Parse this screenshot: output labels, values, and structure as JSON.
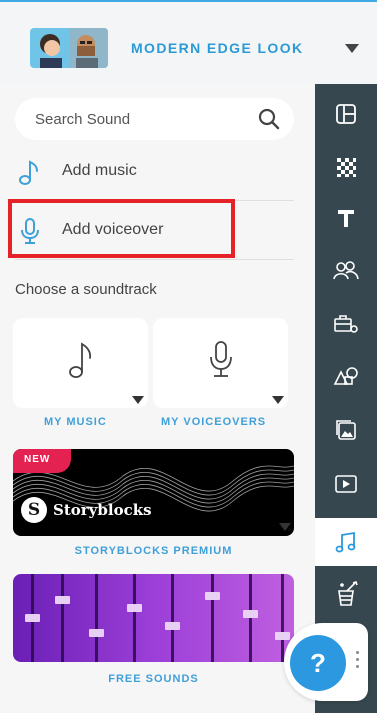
{
  "header": {
    "title": "MODERN EDGE LOOK",
    "avatar_icon": "team-avatar-icon",
    "dropdown_icon": "caret-down-icon"
  },
  "sound_panel": {
    "search": {
      "placeholder": "Search Sound",
      "icon": "search-icon"
    },
    "add_music": {
      "label": "Add music",
      "icon": "music-note-icon"
    },
    "add_voiceover": {
      "label": "Add voiceover",
      "icon": "microphone-icon"
    },
    "choose_heading": "Choose a soundtrack",
    "cards": [
      {
        "label": "MY MUSIC",
        "icon": "music-note-icon"
      },
      {
        "label": "MY VOICEOVERS",
        "icon": "microphone-icon"
      }
    ],
    "storyblocks": {
      "badge": "NEW",
      "brand": "Storyblocks",
      "label": "STORYBLOCKS PREMIUM"
    },
    "free_sounds": {
      "label": "FREE SOUNDS"
    }
  },
  "sidebar_rail": {
    "items": [
      {
        "icon": "layout-icon",
        "active": false
      },
      {
        "icon": "background-pattern-icon",
        "active": false
      },
      {
        "icon": "text-icon",
        "active": false
      },
      {
        "icon": "characters-icon",
        "active": false
      },
      {
        "icon": "props-icon",
        "active": false
      },
      {
        "icon": "shapes-icon",
        "active": false
      },
      {
        "icon": "images-icon",
        "active": false
      },
      {
        "icon": "video-icon",
        "active": false
      },
      {
        "icon": "music-icon",
        "active": true
      },
      {
        "icon": "effects-icon",
        "active": false
      }
    ]
  },
  "help": {
    "label": "?",
    "icon": "help-icon"
  },
  "colors": {
    "accent": "#2b9bd7",
    "rail_bg": "#37474f",
    "highlight_red": "#e42227",
    "new_badge": "#e42251"
  }
}
